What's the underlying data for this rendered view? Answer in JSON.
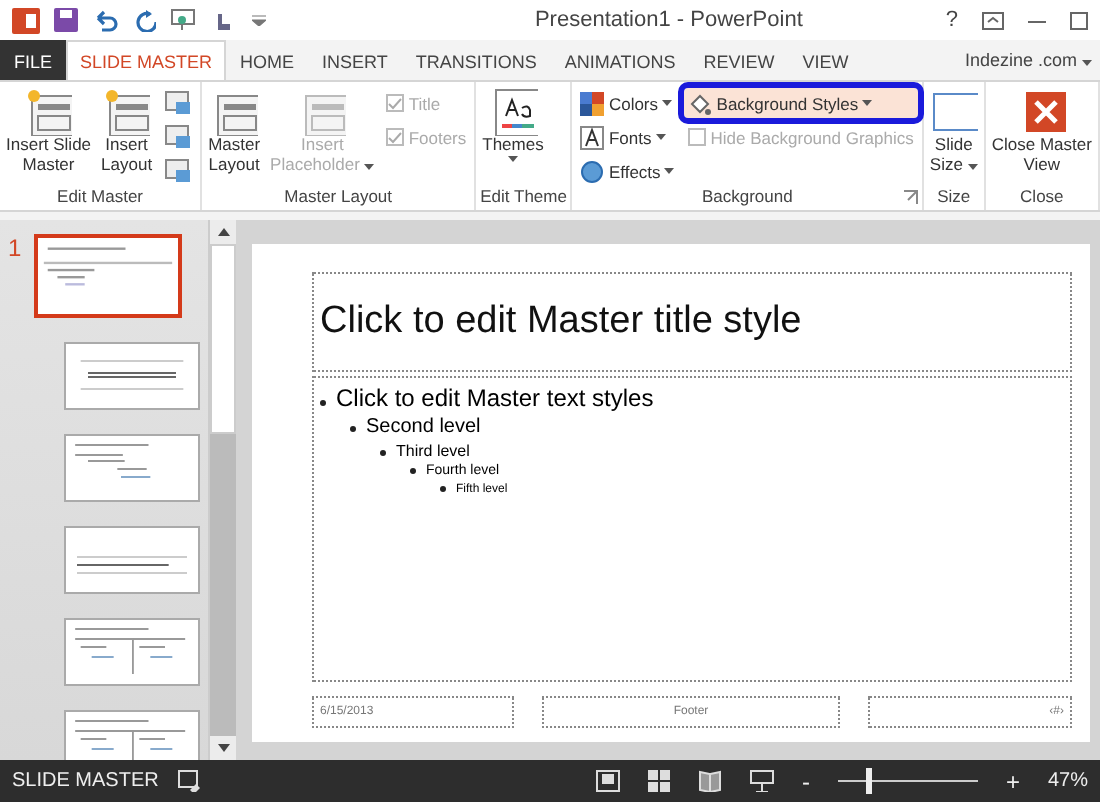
{
  "window": {
    "title": "Presentation1 - PowerPoint",
    "help": "?"
  },
  "tabs": [
    {
      "label": "FILE",
      "kind": "file",
      "selected": false
    },
    {
      "label": "SLIDE MASTER",
      "kind": "tab",
      "selected": true
    },
    {
      "label": "HOME",
      "kind": "tab",
      "selected": false
    },
    {
      "label": "INSERT",
      "kind": "tab",
      "selected": false
    },
    {
      "label": "TRANSITIONS",
      "kind": "tab",
      "selected": false
    },
    {
      "label": "ANIMATIONS",
      "kind": "tab",
      "selected": false
    },
    {
      "label": "REVIEW",
      "kind": "tab",
      "selected": false
    },
    {
      "label": "VIEW",
      "kind": "tab",
      "selected": false
    }
  ],
  "account": "Indezine .com",
  "ribbon": [
    {
      "label": "Edit Master",
      "items": [
        {
          "kind": "large",
          "label": "Insert Slide Master"
        },
        {
          "kind": "large",
          "label": "Insert Layout"
        },
        {
          "kind": "icon"
        },
        {
          "kind": "icon"
        },
        {
          "kind": "icon"
        }
      ]
    },
    {
      "label": "Master Layout",
      "items": [
        {
          "kind": "large",
          "label": "Master Layout"
        },
        {
          "kind": "large",
          "label": "Insert Placeholder",
          "disabled": true,
          "dropdown": true
        },
        {
          "kind": "check",
          "label": "Title",
          "checked": true,
          "disabled": true
        },
        {
          "kind": "check",
          "label": "Footers",
          "checked": true,
          "disabled": true
        }
      ]
    },
    {
      "label": "Edit Theme",
      "items": [
        {
          "kind": "large",
          "label": "Themes",
          "dropdown": true
        }
      ]
    },
    {
      "label": "Background",
      "launcher": true,
      "items": [
        {
          "kind": "small",
          "label": "Colors",
          "dropdown": true
        },
        {
          "kind": "small",
          "label": "Fonts",
          "dropdown": true
        },
        {
          "kind": "small",
          "label": "Effects",
          "dropdown": true
        },
        {
          "kind": "small",
          "label": "Background Styles",
          "dropdown": true,
          "highlighted": true
        },
        {
          "kind": "check",
          "label": "Hide Background Graphics",
          "checked": false,
          "disabled": true
        }
      ]
    },
    {
      "label": "Size",
      "items": [
        {
          "kind": "large",
          "label": "Slide Size",
          "dropdown": true
        }
      ]
    },
    {
      "label": "Close",
      "items": [
        {
          "kind": "large",
          "label": "Close Master View"
        }
      ]
    }
  ],
  "thumbnails": [
    {
      "number": "1",
      "kind": "master",
      "selected": true
    },
    {
      "kind": "title",
      "selected": false
    },
    {
      "kind": "content",
      "selected": false
    },
    {
      "kind": "section",
      "selected": false
    },
    {
      "kind": "two",
      "selected": false
    },
    {
      "kind": "two",
      "selected": false
    }
  ],
  "slide": {
    "title": "Click to edit Master title style",
    "levels": [
      {
        "text": "Click to edit Master text styles",
        "children": [
          {
            "text": "Second level",
            "children": [
              {
                "text": "Third level",
                "children": [
                  {
                    "text": "Fourth level",
                    "children": [
                      {
                        "text": "Fifth level"
                      }
                    ]
                  }
                ]
              }
            ]
          }
        ]
      }
    ],
    "date": "6/15/2013",
    "footer": "Footer",
    "number": "‹#›"
  },
  "status_bar": {
    "view": "SLIDE MASTER",
    "zoom": {
      "level": 0.22,
      "reading": "47%",
      "minus": "-",
      "plus": "+"
    }
  }
}
